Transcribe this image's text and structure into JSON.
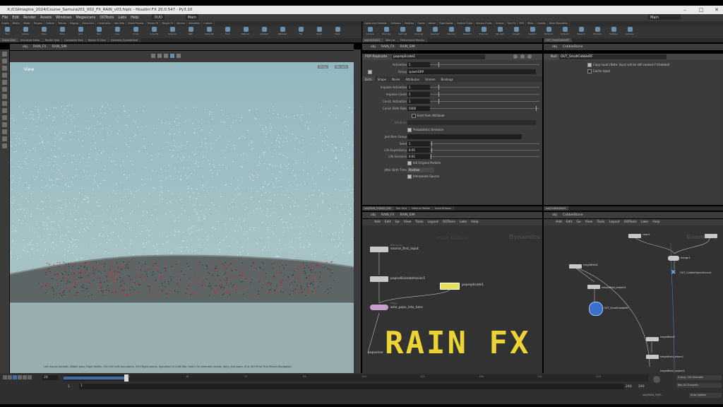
{
  "window": {
    "title": "X:/CGImagine_2024/Course_Samurai/01_002_FX_RAIN_v03.hiplc - Houdini FX 20.0.547 - Py3.10",
    "desktop_label": "Main"
  },
  "menu": [
    "File",
    "Edit",
    "Render",
    "Assets",
    "Windows",
    "Megascans",
    "ODTools",
    "Labs",
    "Help",
    "DUO",
    "Main"
  ],
  "shelf_left": {
    "tabs": [
      "Create",
      "Modify",
      "Model",
      "Polygon",
      "Deform",
      "Texture",
      "Rigging",
      "Characters",
      "Constraints",
      "Hair Utils",
      "Guide Process",
      "Terrain FX",
      "Simple FX",
      "Volume",
      "Animation",
      "Custom"
    ],
    "tools": [
      "Box",
      "Sphere",
      "Tube",
      "Torus",
      "Grid",
      "Null",
      "Line",
      "Circle",
      "Curve Bezier",
      "Draw Curve",
      "Path",
      "Spray Paint",
      "Font",
      "Platonic Solids",
      "L-System",
      "Metaball",
      "File",
      "Spiral",
      "Helix"
    ]
  },
  "shelf_right": {
    "tabs": [
      "Lights and Cameras",
      "Collisions",
      "Particles",
      "Grains",
      "Vellum",
      "Rigid Bodies",
      "Particle Fluids",
      "Viscous Fluids",
      "Oceans",
      "Pyro FX",
      "FEM",
      "Wires",
      "Crowds",
      "Drive Simulation"
    ],
    "tools": [
      "Camera",
      "Point Light",
      "Spot Light",
      "Area Light",
      "Geometry Light",
      "Volume Light",
      "Distant Light",
      "Environment Light",
      "Sky Light",
      "GI Light",
      "Caustic Light",
      "Portal Light",
      "Ambient Light",
      "Stereo Camera",
      "VR Camera",
      "Switcher",
      "Gamepad Camera"
    ]
  },
  "viewport": {
    "tabs": [
      "Scene View",
      "Animation Editor",
      "Render View",
      "Composite View",
      "Motion FX View",
      "Geometry Spreadsheet"
    ],
    "path": [
      "obj",
      "RAIN_FX",
      "RAIN_SIM"
    ],
    "label": "View",
    "persp": "Persp",
    "cam": "No cam",
    "hint": "Left mouse tumbles. Middle pans. Right dollies. Ctrl+Alt+Left box-zooms. Ctrl+Right zooms. Spacebar-Ctrl-Left tilts. Hold L for alternate tumble, dolly, and zoom. M or Alt+M for First Person Navigation."
  },
  "param": {
    "tabs": [
      "popreplicate1",
      "Take List",
      "Performance Monitor"
    ],
    "path": [
      "obj",
      "RAIN_FX",
      "RAIN_SIM"
    ],
    "node_type": "POP Replicate",
    "node_name": "popreplicate1",
    "activation_label": "Activation",
    "activation_value": "1",
    "group_label": "Group",
    "group_value": "splashGRP",
    "subtabs": [
      "Birth",
      "Shape",
      "Noise",
      "Attributes",
      "Stream",
      "Bindings"
    ],
    "rows": [
      {
        "label": "Impulse Activation",
        "value": "1"
      },
      {
        "label": "Impulse Count",
        "value": "5"
      },
      {
        "label": "Const. Activation",
        "value": "1"
      },
      {
        "label": "Const. Birth Rate",
        "value": "5000"
      }
    ],
    "emit_from_attr": "Emit from Attribute",
    "attribute_label": "Attribute",
    "probabilistic": "Probabilistic Emission",
    "just_born": "Just Born Group",
    "seed_label": "Seed",
    "seed_value": "1",
    "life_exp_label": "Life Expectancy",
    "life_exp_value": "0.05",
    "life_var_label": "Life Variance",
    "life_var_value": "0.01",
    "kill_original": "Kill Original Particle",
    "jitter_label": "Jitter Birth Time",
    "jitter_value": "Positive",
    "interpolate": "Interpolate Source"
  },
  "param2": {
    "tabs": [
      "OUT_SmallCobbleRF"
    ],
    "path": [
      "obj",
      "CobbleStone"
    ],
    "node_type": "Null",
    "node_name": "OUT_SmallCobbleRF",
    "copy_input": "Copy Input (Note: Input will be still cooked if disabled)",
    "cache_input": "Cache Input"
  },
  "net1": {
    "tabs": [
      "/obj/RAIN_FX/RAIN_SIM",
      "Tree View",
      "Material Palette",
      "Asset Browser"
    ],
    "path": [
      "obj",
      "RAIN_FX",
      "RAIN_SIM"
    ],
    "menu": [
      "Add",
      "Edit",
      "Go",
      "View",
      "Tools",
      "Layout",
      "ODTools",
      "Labs",
      "Help"
    ],
    "watermark1": "Indie Edition",
    "watermark2": "Dynamics",
    "nodes": [
      {
        "label": "source_first_input",
        "sub": "POP Source"
      },
      {
        "label": "popcollisionbehavior1",
        "sub": ""
      },
      {
        "label": "popreplicate1",
        "sub": ""
      },
      {
        "label": "wire_pops_into_here",
        "sub": "Merge"
      },
      {
        "label": "popsolver",
        "sub": ""
      }
    ]
  },
  "net2": {
    "tabs": [
      "/obj/CobbleStone"
    ],
    "path": [
      "obj",
      "CobbleStone"
    ],
    "menu": [
      "Add",
      "Edit",
      "Go",
      "View",
      "Tools",
      "Layout",
      "ODTools",
      "Labs",
      "Help"
    ],
    "watermark": "Geometry",
    "nodes": [
      "color1",
      "heightfield1",
      "merge1",
      "OUT_CobbleStoneGround",
      "heightfield_project1",
      "OUT_SmallCobbleRF",
      "heightfield2",
      "heightfield_xform1",
      "heightfield_project2"
    ]
  },
  "timeline": {
    "frame": "28",
    "start": "1",
    "start2": "1",
    "end": "240",
    "end2": "240",
    "ticks": [
      "24",
      "48",
      "72",
      "96",
      "120",
      "144",
      "168",
      "192",
      "216"
    ],
    "keys_label": "0 keys, 0/0 channels",
    "key_all": "Key All Channels",
    "auto_update": "Auto Update",
    "status_path": "/obj/RAIN_FX/R..."
  },
  "overlay": {
    "title": "RAIN FX"
  },
  "colors": {
    "accent": "#ecd336",
    "panel": "#3b3b3b",
    "network_bg": "#323232",
    "node": "#c9c9c9",
    "active_node": "#e8e158"
  }
}
